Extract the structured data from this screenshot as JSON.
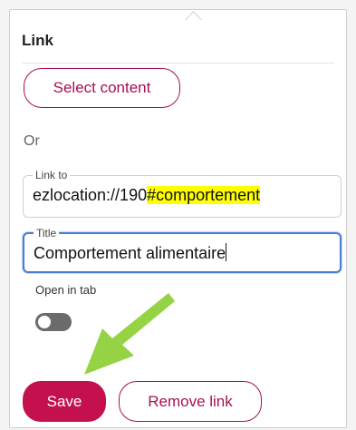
{
  "panel": {
    "title": "Link",
    "select_content_label": "Select content",
    "or_label": "Or",
    "link_to": {
      "label": "Link to",
      "value_prefix": "ezlocation://190",
      "value_highlight": "#comportement"
    },
    "title_field": {
      "label": "Title",
      "value": "Comportement alimentaire"
    },
    "open_in_tab": {
      "label": "Open in tab",
      "checked": false
    },
    "save_label": "Save",
    "remove_label": "Remove link"
  },
  "colors": {
    "accent": "#a80f52",
    "save_bg": "#c4104e",
    "highlight": "#ffff00",
    "focus_border": "#4a7ed0",
    "arrow": "#8fd13b"
  },
  "annotations": {
    "arrow_icon": "green-pointer-arrow"
  }
}
